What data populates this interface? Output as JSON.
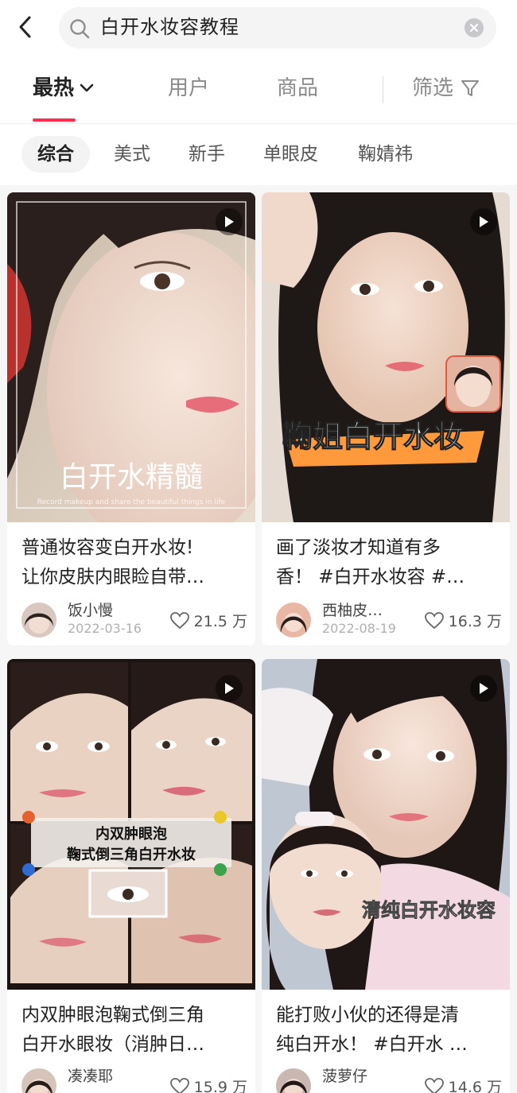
{
  "search": {
    "query": "白开水妆容教程"
  },
  "tabs": {
    "hot": "最热",
    "user": "用户",
    "goods": "商品",
    "filter": "筛选"
  },
  "tags": [
    "综合",
    "美式",
    "新手",
    "单眼皮",
    "鞠婧祎"
  ],
  "cards": [
    {
      "title_line1": "普通妆容变白开水妆!",
      "title_line2": "让你皮肤内眼睑自带…",
      "author": "饭小慢",
      "date": "2022-03-16",
      "likes": "21.5 万",
      "overlay_main": "白开水精髓",
      "overlay_sub": "Record makeup and share the beautiful things in life"
    },
    {
      "title_line1": "画了淡妆才知道有多",
      "title_line2": "香！ #白开水妆容 #…",
      "author": "西柚皮…",
      "date": "2022-08-19",
      "likes": "16.3 万",
      "overlay_main": "鞠姐白开水妆"
    },
    {
      "title_line1": "内双肿眼泡鞠式倒三角",
      "title_line2": "白开水眼妆（消肿日…",
      "author": "凑凑耶",
      "date": "",
      "likes": "15.9 万",
      "overlay_line1": "内双肿眼泡",
      "overlay_line2": "鞠式倒三角白开水妆"
    },
    {
      "title_line1": "能打败小伙的还得是清",
      "title_line2": "纯白开水！ #白开水 …",
      "author": "菠萝仔",
      "date": "",
      "likes": "14.6 万",
      "overlay_main": "清纯白开水妆容"
    }
  ],
  "colors": {
    "accent": "#ff2e4d",
    "chip_bg": "#f3f3f4",
    "feed_bg": "#f6f6f6"
  }
}
